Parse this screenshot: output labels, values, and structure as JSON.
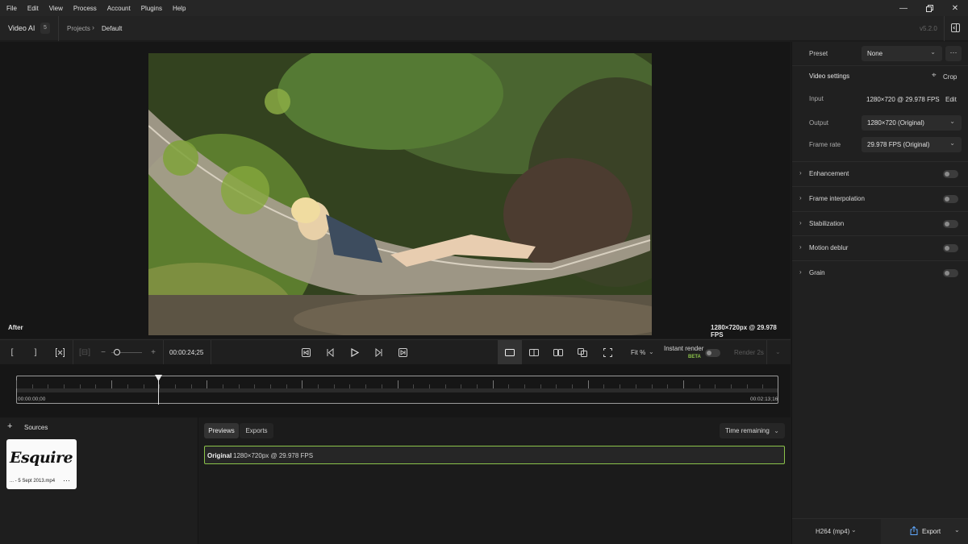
{
  "menubar": {
    "items": [
      "File",
      "Edit",
      "View",
      "Process",
      "Account",
      "Plugins",
      "Help"
    ]
  },
  "titlebar": {
    "app_name": "Video AI",
    "badge": "5",
    "breadcrumb_root": "Projects",
    "breadcrumb_current": "Default",
    "version": "v5.2.0"
  },
  "viewer": {
    "view_label": "After",
    "video_info": "1280×720px @ 29.978 FPS"
  },
  "controls": {
    "timecode": "00:00:24;25",
    "fit_label": "Fit %",
    "instant_render_label": "Instant render",
    "beta_label": "BETA",
    "render_label": "Render 2s",
    "zoom_level": 0.15
  },
  "timeline": {
    "start_time": "00:00:00;00",
    "end_time": "00:02:13;16",
    "playhead_fraction": 0.186
  },
  "sources": {
    "title": "Sources",
    "file_name": "... - 5 Sept 2013.mp4",
    "thumb_text": "Esquire"
  },
  "previews": {
    "tabs": [
      "Previews",
      "Exports"
    ],
    "sort_label": "Time remaining",
    "row_name": "Original",
    "row_info": "1280×720px @ 29.978 FPS"
  },
  "rightpanel": {
    "preset_label": "Preset",
    "preset_value": "None",
    "video_settings_label": "Video settings",
    "crop_label": "Crop",
    "input_label": "Input",
    "input_value": "1280×720 @ 29.978 FPS",
    "edit_label": "Edit",
    "output_label": "Output",
    "output_value": "1280×720 (Original)",
    "framerate_label": "Frame rate",
    "framerate_value": "29.978 FPS (Original)",
    "sections": [
      "Enhancement",
      "Frame interpolation",
      "Stabilization",
      "Motion deblur",
      "Grain"
    ],
    "format_value": "H264 (mp4)",
    "export_label": "Export"
  },
  "colors": {
    "accent_green": "#8bc34a",
    "panel": "#202020",
    "background": "#161616"
  }
}
